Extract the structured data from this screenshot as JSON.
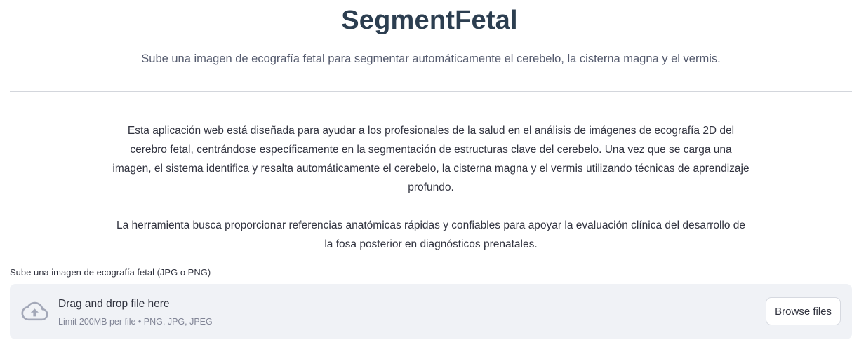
{
  "header": {
    "title": "SegmentFetal",
    "subtitle": "Sube una imagen de ecografía fetal para segmentar automáticamente el cerebelo, la cisterna magna y el vermis."
  },
  "description": {
    "paragraph_1": "Esta aplicación web está diseñada para ayudar a los profesionales de la salud en el análisis de imágenes de ecografía 2D del cerebro fetal, centrándose específicamente en la segmentación de estructuras clave del cerebelo. Una vez que se carga una imagen, el sistema identifica y resalta automáticamente el cerebelo, la cisterna magna y el vermis utilizando técnicas de aprendizaje profundo.",
    "paragraph_2": "La herramienta busca proporcionar referencias anatómicas rápidas y confiables para apoyar la evaluación clínica del desarrollo de la fosa posterior en diagnósticos prenatales."
  },
  "uploader": {
    "label": "Sube una imagen de ecografía fetal (JPG o PNG)",
    "drop_text": "Drag and drop file here",
    "limit_text": "Limit 200MB per file • PNG, JPG, JPEG",
    "browse_label": "Browse files",
    "icon": "cloud-upload-icon"
  },
  "colors": {
    "title": "#2c3e50",
    "dropzone_bg": "#f0f2f6",
    "icon": "#a3a8b8"
  }
}
